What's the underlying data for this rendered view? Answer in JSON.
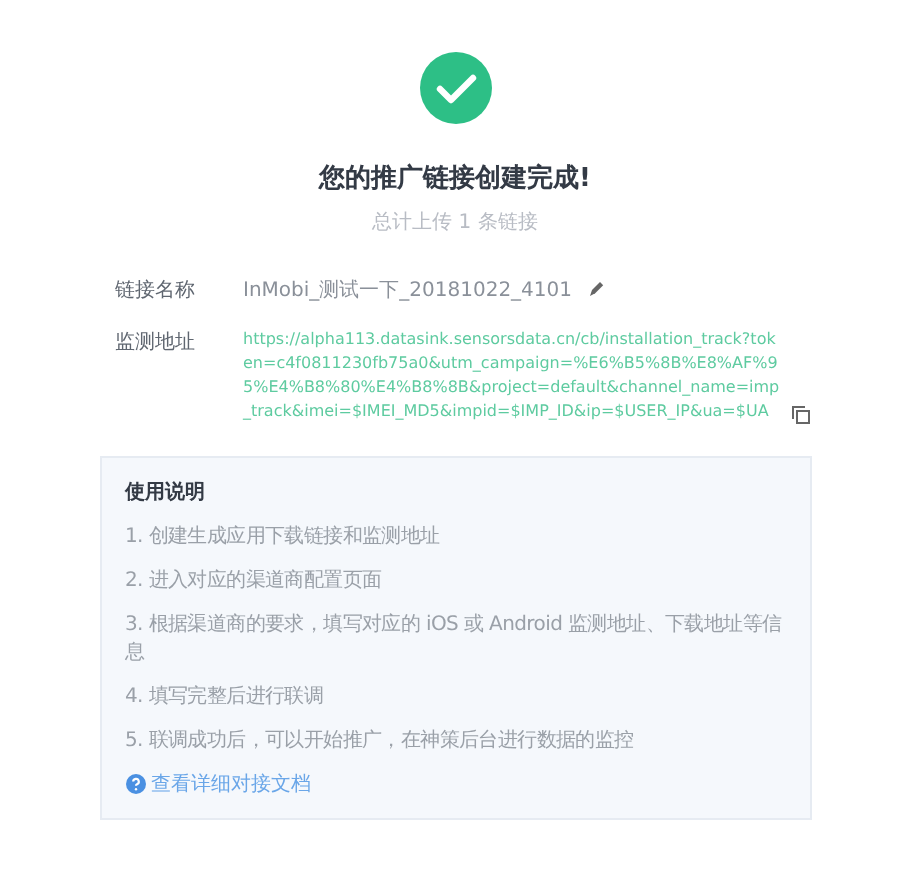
{
  "status": {
    "title": "您的推广链接创建完成!",
    "subtitle": "总计上传 1 条链接"
  },
  "fields": [
    {
      "kind": "name",
      "label": "链接名称",
      "value": "InMobi_测试一下_20181022_4101"
    },
    {
      "kind": "url",
      "label": "监测地址",
      "value": "https://alpha113.datasink.sensorsdata.cn/cb/installation_track?token=c4f0811230fb75a0&utm_campaign=%E6%B5%8B%E8%AF%95%E4%B8%80%E4%B8%8B&project=default&channel_name=imp_track&imei=$IMEI_MD5&impid=$IMP_ID&ip=$USER_IP&ua=$UA"
    }
  ],
  "instructions": {
    "title": "使用说明",
    "steps": [
      "1. 创建生成应用下载链接和监测地址",
      "2. 进入对应的渠道商配置页面",
      "3. 根据渠道商的要求，填写对应的 iOS 或 Android 监测地址、下载地址等信息",
      "4. 填写完整后进行联调",
      "5. 联调成功后，可以开始推广，在神策后台进行数据的监控"
    ],
    "link": "查看详细对接文档"
  }
}
